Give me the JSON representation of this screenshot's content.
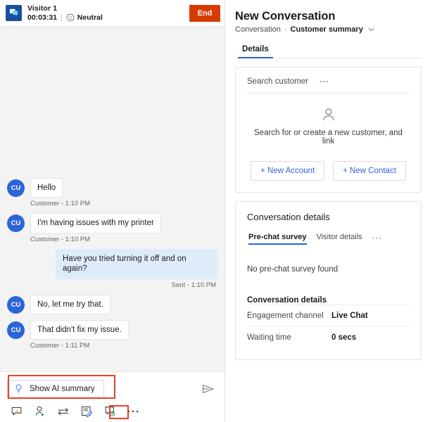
{
  "chat": {
    "header": {
      "avatar_icon": "chat-message-icon",
      "visitor_name": "Visitor 1",
      "timer": "00:03:31",
      "separator": "|",
      "sentiment_icon": "neutral-face-icon",
      "sentiment_label": "Neutral",
      "end_label": "End",
      "end_color": "#d83b01"
    },
    "messages": [
      {
        "sender": "customer",
        "avatar": "CU",
        "text": "Hello",
        "meta": "Customer - 1:10 PM",
        "show_meta": true
      },
      {
        "sender": "customer",
        "avatar": "CU",
        "text": "I'm having issues with my printer",
        "meta": "Customer - 1:10 PM",
        "show_meta": true
      },
      {
        "sender": "agent",
        "avatar": "",
        "text": "Have you tried turning it off and on again?",
        "meta": "Sent - 1:10 PM",
        "show_meta": true
      },
      {
        "sender": "customer",
        "avatar": "CU",
        "text": "No, let me try that.",
        "meta": "",
        "show_meta": false
      },
      {
        "sender": "customer",
        "avatar": "CU",
        "text": "That didn't fix my issue.",
        "meta": "Customer - 1:11 PM",
        "show_meta": true
      }
    ],
    "compose": {
      "ai_summary_label": "Show AI summary",
      "ai_summary_icon": "lightbulb-icon",
      "send_icon": "send-paper-plane-icon",
      "tools": [
        {
          "icon": "quick-replies-icon",
          "name": "quick-replies"
        },
        {
          "icon": "add-agent-icon",
          "name": "add-agent"
        },
        {
          "icon": "transfer-icon",
          "name": "transfer"
        },
        {
          "icon": "notes-icon",
          "name": "notes"
        },
        {
          "icon": "consult-icon",
          "name": "consult"
        },
        {
          "icon": "more-ellipsis-icon",
          "name": "more-options"
        }
      ]
    },
    "highlights": {
      "color": "#e8402a",
      "items": [
        "show-ai-summary-button",
        "more-options-button"
      ]
    }
  },
  "details": {
    "title": "New Conversation",
    "breadcrumb": {
      "root": "Conversation",
      "dot": "·",
      "current": "Customer summary",
      "chevron": "⌄"
    },
    "tabs": [
      {
        "label": "Details",
        "active": true
      }
    ],
    "customer_card": {
      "search_label": "Search customer",
      "search_value": "---",
      "person_icon": "person-outline-icon",
      "empty_text": "Search for or create a new customer, and link",
      "new_account_label": "+ New Account",
      "new_contact_label": "+ New Contact"
    },
    "conversation_card": {
      "title": "Conversation details",
      "tabs": [
        {
          "label": "Pre-chat survey",
          "active": true
        },
        {
          "label": "Visitor details",
          "active": false
        },
        {
          "label": "...",
          "active": false,
          "is_more": true
        }
      ],
      "empty_note": "No pre-chat survey found",
      "section_heading": "Conversation details",
      "rows": [
        {
          "key": "Engagement channel",
          "value": "Live Chat"
        },
        {
          "key": "Waiting time",
          "value": "0 secs"
        }
      ]
    }
  },
  "theme": {
    "accent": "#2b65d9",
    "avatar_blue": "#2b65d9",
    "agent_bubble": "#deecf9",
    "danger": "#d83b01"
  }
}
